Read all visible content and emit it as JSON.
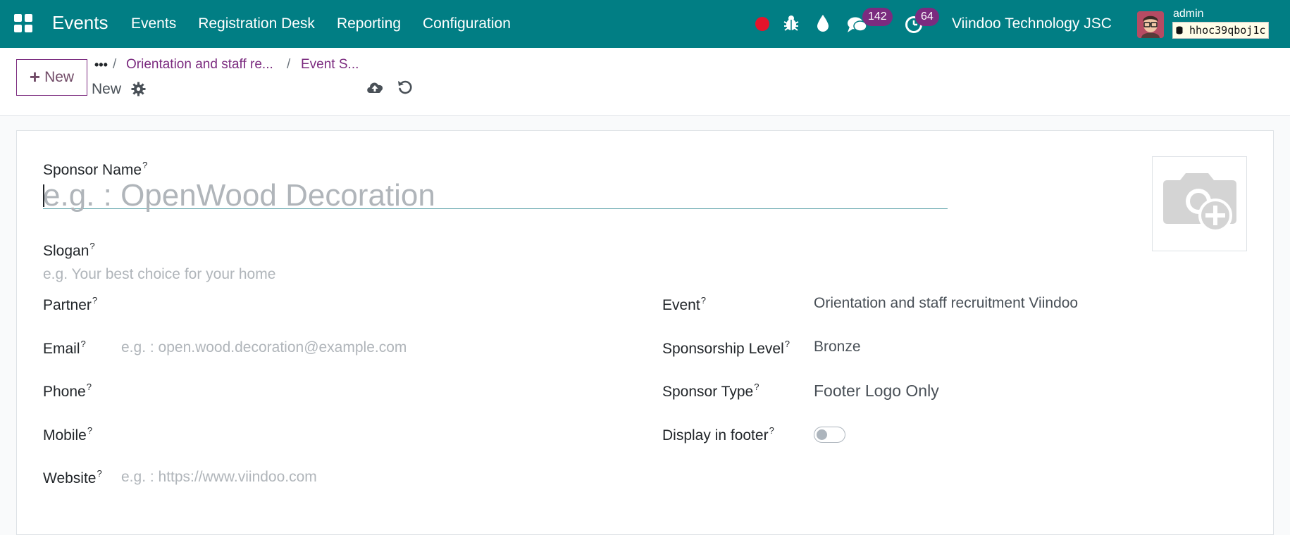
{
  "navbar": {
    "brand": "Events",
    "menu": [
      "Events",
      "Registration Desk",
      "Reporting",
      "Configuration"
    ],
    "chat_count": "142",
    "activity_count": "64",
    "company": "Viindoo Technology JSC",
    "user": "admin",
    "database": "hhoc39qboj1c",
    "icons": [
      "apps-icon",
      "recording-dot",
      "bug-icon",
      "drop-icon",
      "chat-icon",
      "clock-icon"
    ]
  },
  "control": {
    "new_label": "New",
    "breadcrumb_dots": "•••",
    "breadcrumb": [
      "Orientation and staff re...",
      "Event S..."
    ],
    "record_title": "New"
  },
  "form": {
    "sponsor_name_label": "Sponsor Name",
    "sponsor_name_placeholder": "e.g. : OpenWood Decoration",
    "slogan_label": "Slogan",
    "slogan_placeholder": "e.g. Your best choice for your home",
    "partner_label": "Partner",
    "email_label": "Email",
    "email_placeholder": "e.g. : open.wood.decoration@example.com",
    "phone_label": "Phone",
    "mobile_label": "Mobile",
    "website_label": "Website",
    "website_placeholder": "e.g. : https://www.viindoo.com",
    "event_label": "Event",
    "event_value": "Orientation and staff recruitment Viindoo",
    "level_label": "Sponsorship Level",
    "level_value": "Bronze",
    "type_label": "Sponsor Type",
    "type_value": "Footer Logo Only",
    "footer_label": "Display in footer",
    "footer_enabled": false,
    "help_mark": "?"
  },
  "colors": {
    "navbar": "#017e84",
    "accent": "#7b2b7f",
    "badge": "#7b2b7f",
    "record": "#e5142b"
  }
}
